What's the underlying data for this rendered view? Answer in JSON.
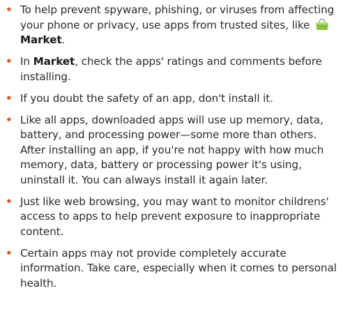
{
  "bullet_color": "#e2571e",
  "text_color": "#2a2a2a",
  "items": [
    {
      "before": "To help prevent spyware, phishing, or viruses from affecting your phone or privacy, use apps from trusted sites, like",
      "icon": "market-bag-icon",
      "bold": "Market",
      "after": "."
    },
    {
      "prefix": "In ",
      "bold": "Market",
      "after": ", check the apps' ratings and comments before installing."
    },
    {
      "text": "If you doubt the safety of an app, don't install it."
    },
    {
      "text": "Like all apps, downloaded apps will use up memory, data, battery, and processing power—some more than others. After installing an app, if you're not happy with how much memory, data, battery or processing power it's using, uninstall it. You can always install it again later."
    },
    {
      "text": "Just like web browsing, you may want to monitor childrens' access to apps to help prevent exposure to inappropriate content."
    },
    {
      "text": "Certain apps may not provide completely accurate information. Take care, especially when it comes to personal health."
    }
  ]
}
